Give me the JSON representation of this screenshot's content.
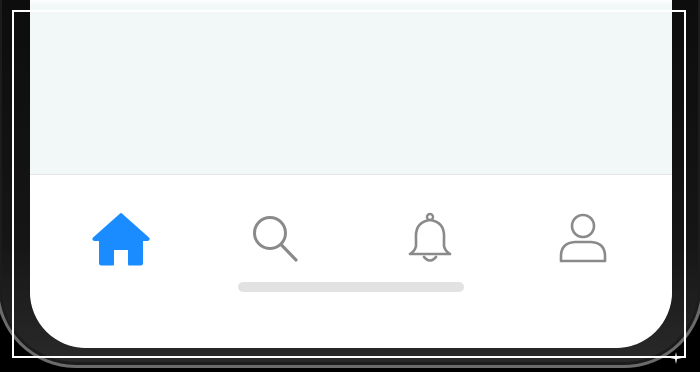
{
  "tab_bar": {
    "tabs": [
      {
        "id": "home",
        "icon": "home-icon",
        "active": true
      },
      {
        "id": "search",
        "icon": "search-icon",
        "active": false
      },
      {
        "id": "notifications",
        "icon": "bell-icon",
        "active": false
      },
      {
        "id": "profile",
        "icon": "user-icon",
        "active": false
      }
    ]
  },
  "colors": {
    "active_tab": "#1a8cff",
    "inactive_tab": "#8a8a8a",
    "content_background": "#f2f7f8",
    "tab_bar_background": "#ffffff",
    "home_indicator": "#e2e2e2"
  }
}
